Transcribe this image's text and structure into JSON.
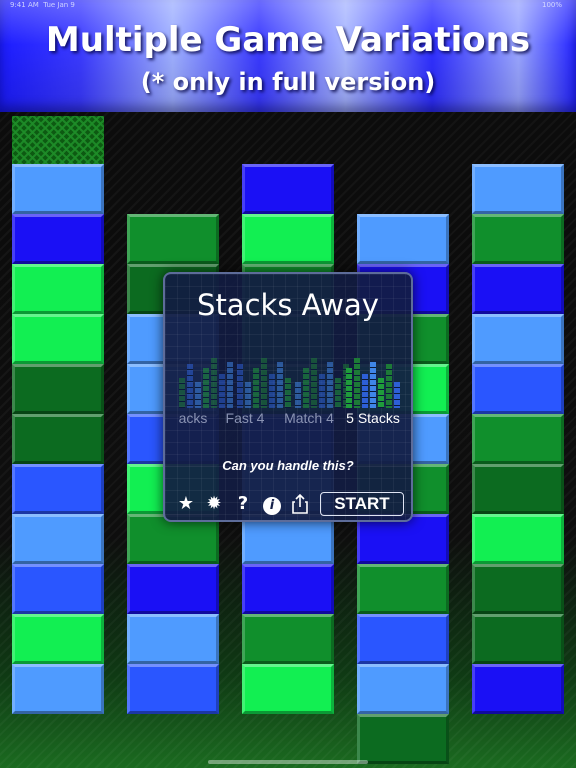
{
  "status_bar": {
    "time": "9:41 AM",
    "date": "Tue Jan 9",
    "battery": "100%"
  },
  "banner": {
    "title": "Multiple Game Variations",
    "subtitle": "(* only in full version)"
  },
  "colors": {
    "light_blue": "#4f9bff",
    "blue": "#2a56ff",
    "dark_blue": "#1a10f5",
    "bright_green": "#12ef52",
    "green": "#108f2c",
    "dark_green": "#0c6b20"
  },
  "board": {
    "columns": [
      {
        "top_hatched": true,
        "blocks": [
          "light_blue",
          "dark_blue",
          "bright_green",
          "bright_green",
          "dark_green",
          "dark_green",
          "blue",
          "light_blue",
          "blue",
          "bright_green",
          "light_blue"
        ]
      },
      {
        "top_hatched": false,
        "blocks": [
          "green",
          "dark_green",
          "light_blue",
          "light_blue",
          "blue",
          "bright_green",
          "green",
          "dark_blue",
          "light_blue",
          "blue"
        ]
      },
      {
        "top_hatched": false,
        "blocks": [
          "dark_blue",
          "bright_green",
          "green",
          "green",
          "green",
          "blue",
          "light_blue",
          "light_blue",
          "dark_blue",
          "green",
          "bright_green"
        ]
      },
      {
        "top_hatched": false,
        "blocks": [
          "light_blue",
          "dark_blue",
          "green",
          "bright_green",
          "light_blue",
          "green",
          "dark_blue",
          "green",
          "blue",
          "light_blue",
          "dark_green"
        ]
      },
      {
        "top_hatched": false,
        "blocks": [
          "light_blue",
          "green",
          "dark_blue",
          "light_blue",
          "blue",
          "green",
          "dark_green",
          "bright_green",
          "dark_green",
          "dark_green",
          "dark_blue"
        ]
      }
    ]
  },
  "dialog": {
    "title": "Stacks Away",
    "variants": [
      {
        "label": "acks",
        "selected": false
      },
      {
        "label": "Fast 4",
        "selected": false
      },
      {
        "label": "Match 4",
        "selected": false
      },
      {
        "label": "5 Stacks",
        "selected": true
      }
    ],
    "question": "Can you handle this?",
    "icons": [
      {
        "name": "star-icon",
        "glyph": "★"
      },
      {
        "name": "sun-icon",
        "glyph": "✹"
      },
      {
        "name": "help-icon",
        "glyph": "?"
      },
      {
        "name": "info-icon",
        "glyph": "i"
      },
      {
        "name": "share-icon",
        "glyph": "⇧"
      }
    ],
    "start_label": "START"
  }
}
